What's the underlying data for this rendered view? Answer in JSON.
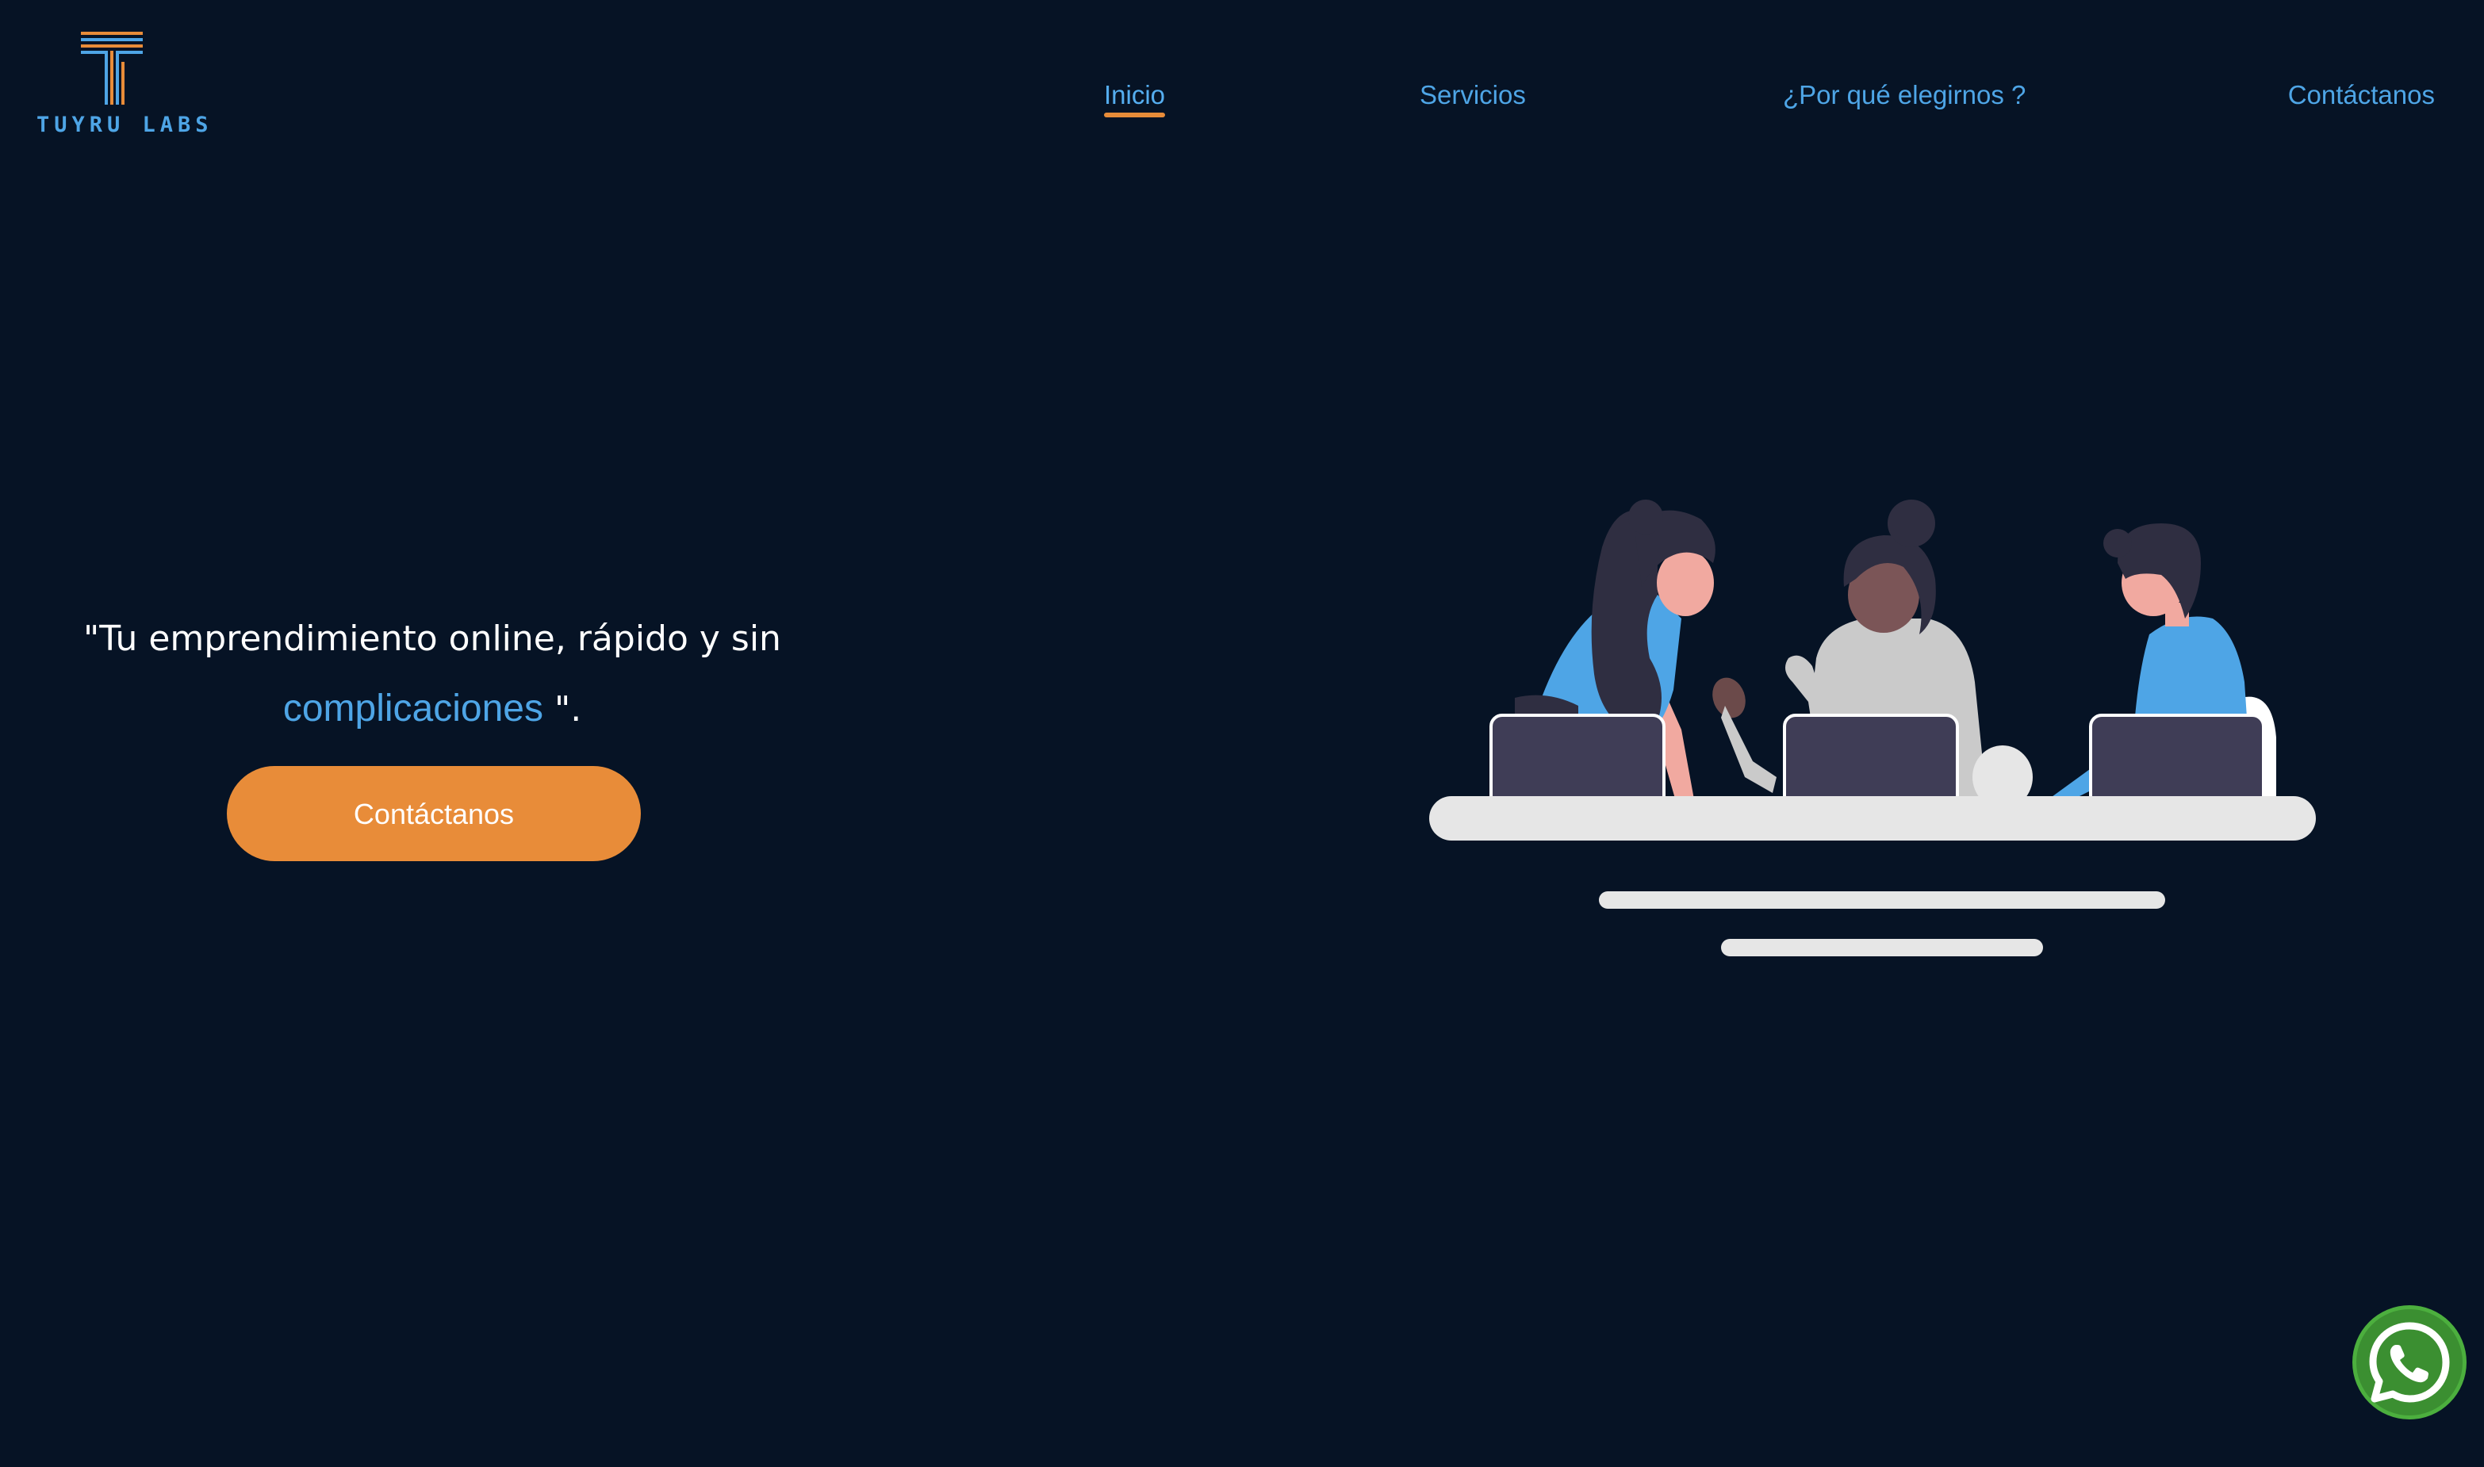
{
  "header": {
    "logo_text": "TUYRU LABS",
    "nav": [
      {
        "label": "Inicio",
        "active": true
      },
      {
        "label": "Servicios",
        "active": false
      },
      {
        "label": "¿Por qué elegirnos ?",
        "active": false
      },
      {
        "label": "Contáctanos",
        "active": false
      }
    ]
  },
  "hero": {
    "tagline_part1": "\"Tu emprendimiento online, rápido y sin",
    "tagline_accent": "complicaciones",
    "tagline_part2": " \".",
    "cta_label": "Contáctanos",
    "illustration_icon": "team-working-illustration"
  },
  "floating": {
    "whatsapp_icon": "whatsapp-icon"
  },
  "colors": {
    "background": "#061325",
    "accent_blue": "#4ea5e6",
    "accent_orange": "#e88c39",
    "whatsapp_green": "#4caf3e"
  }
}
